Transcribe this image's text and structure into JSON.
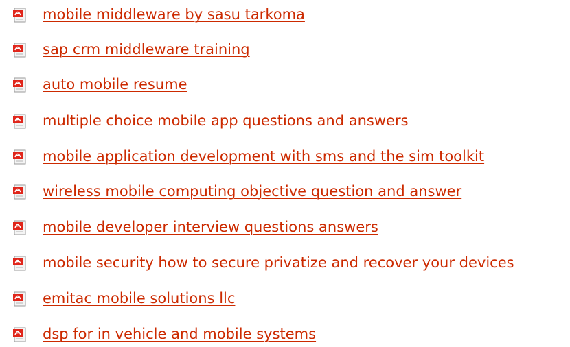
{
  "links": [
    {
      "label": "mobile middleware by sasu tarkoma",
      "icon": "pdf-file-icon"
    },
    {
      "label": "sap crm middleware training",
      "icon": "pdf-file-icon"
    },
    {
      "label": "auto mobile resume",
      "icon": "pdf-file-icon"
    },
    {
      "label": "multiple choice mobile app questions and answers",
      "icon": "pdf-file-icon"
    },
    {
      "label": "mobile application development with sms and the sim toolkit",
      "icon": "pdf-file-icon"
    },
    {
      "label": "wireless mobile computing objective question and answer",
      "icon": "pdf-file-icon"
    },
    {
      "label": "mobile developer interview questions answers",
      "icon": "pdf-file-icon"
    },
    {
      "label": "mobile security how to secure privatize and recover your devices",
      "icon": "pdf-file-icon"
    },
    {
      "label": "emitac mobile solutions llc",
      "icon": "pdf-file-icon"
    },
    {
      "label": "dsp for in vehicle and mobile systems",
      "icon": "pdf-file-icon"
    }
  ],
  "colors": {
    "link": "#cc2a00",
    "icon_red": "#e0261b",
    "icon_page": "#f4f4f4"
  }
}
